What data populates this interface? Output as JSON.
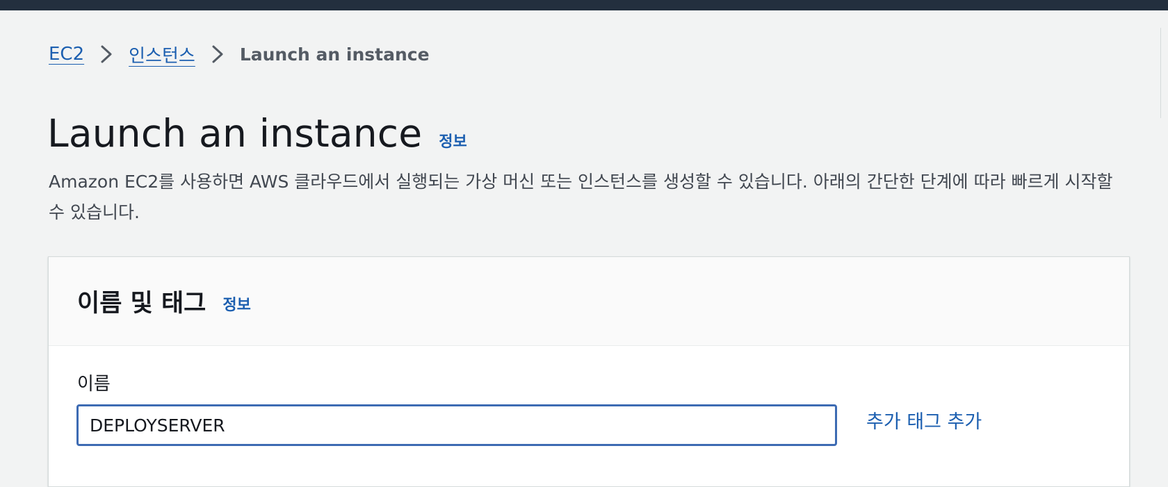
{
  "breadcrumb": {
    "items": [
      "EC2",
      "인스턴스"
    ],
    "current": "Launch an instance"
  },
  "page": {
    "title": "Launch an instance",
    "info_label": "정보",
    "description": "Amazon EC2를 사용하면 AWS 클라우드에서 실행되는 가상 머신 또는 인스턴스를 생성할 수 있습니다. 아래의 간단한 단계에 따라 빠르게 시작할 수 있습니다."
  },
  "name_tags_panel": {
    "title": "이름 및 태그",
    "info_label": "정보",
    "name_label": "이름",
    "name_value": "DEPLOYSERVER",
    "add_tag_link": "추가 태그 추가"
  },
  "colors": {
    "link": "#1c5fb0",
    "topbar": "#232f3e",
    "focus_border": "#3d6bb3"
  },
  "icons": {
    "breadcrumb_separator": "chevron-right-icon"
  }
}
